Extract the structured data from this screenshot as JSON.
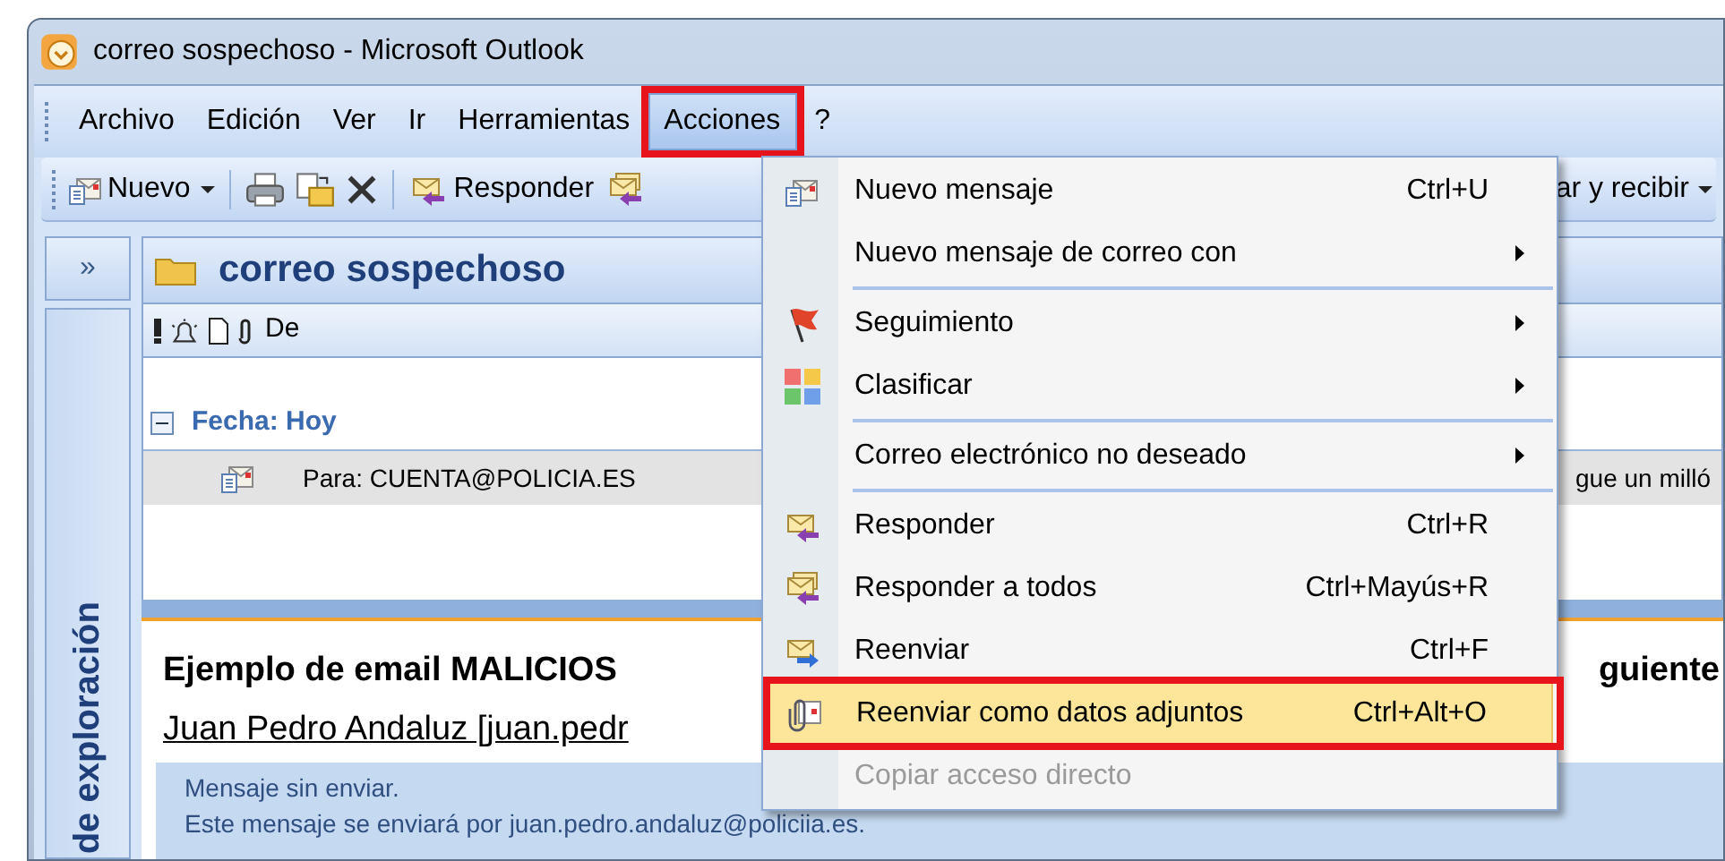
{
  "window": {
    "title": "correo sospechoso - Microsoft Outlook"
  },
  "menu_bar": [
    {
      "label": "Archivo",
      "selected": false,
      "annotated": false
    },
    {
      "label": "Edición",
      "selected": false,
      "annotated": false
    },
    {
      "label": "Ver",
      "selected": false,
      "annotated": false
    },
    {
      "label": "Ir",
      "selected": false,
      "annotated": false
    },
    {
      "label": "Herramientas",
      "selected": false,
      "annotated": false
    },
    {
      "label": "Acciones",
      "selected": true,
      "annotated": true
    },
    {
      "label": "?",
      "selected": false,
      "annotated": false
    }
  ],
  "toolbar": {
    "new_button": "Nuevo",
    "reply_button": "Responder",
    "send_receive_button": "ar y recibir"
  },
  "nav_pane": {
    "expand_button": "»",
    "title": "de exploración"
  },
  "folder": {
    "title": "correo sospechoso",
    "columns": [
      "De"
    ],
    "group": {
      "label": "Fecha: Hoy",
      "expanded": true
    },
    "messages": [
      {
        "to": "Para: CUENTA@POLICIA.ES",
        "subject": "gue un milló",
        "selected": true
      }
    ]
  },
  "reading_pane": {
    "subject_start": "Ejemplo de email MALICIOS",
    "subject_end": "guiente",
    "sender": "Juan Pedro Andaluz [juan.pedr",
    "info": [
      "Mensaje sin enviar.",
      "Este mensaje se enviará por juan.pedro.andaluz@policiia.es."
    ]
  },
  "context_menu": {
    "items": [
      {
        "label": "Nuevo mensaje",
        "shortcut": "Ctrl+U",
        "submenu": false,
        "disabled": false,
        "selected": false,
        "annotated": false,
        "separator_before": false
      },
      {
        "label": "Nuevo mensaje de correo con",
        "submenu": true,
        "disabled": false,
        "selected": false,
        "annotated": false,
        "separator_before": false
      },
      {
        "label": "Seguimiento",
        "submenu": true,
        "disabled": false,
        "selected": false,
        "annotated": false,
        "separator_before": true
      },
      {
        "label": "Clasificar",
        "submenu": true,
        "disabled": false,
        "selected": false,
        "annotated": false,
        "separator_before": false
      },
      {
        "label": "Correo electrónico no deseado",
        "submenu": true,
        "disabled": false,
        "selected": false,
        "annotated": false,
        "separator_before": true
      },
      {
        "label": "Responder",
        "shortcut": "Ctrl+R",
        "submenu": false,
        "disabled": false,
        "selected": false,
        "annotated": false,
        "separator_before": true
      },
      {
        "label": "Responder a todos",
        "shortcut": "Ctrl+Mayús+R",
        "submenu": false,
        "disabled": false,
        "selected": false,
        "annotated": false,
        "separator_before": false
      },
      {
        "label": "Reenviar",
        "shortcut": "Ctrl+F",
        "submenu": false,
        "disabled": false,
        "selected": false,
        "annotated": false,
        "separator_before": false
      },
      {
        "label": "Reenviar como datos adjuntos",
        "shortcut": "Ctrl+Alt+O",
        "submenu": false,
        "disabled": false,
        "selected": true,
        "annotated": true,
        "separator_before": false
      },
      {
        "label": "Copiar acceso directo",
        "submenu": false,
        "disabled": true,
        "selected": false,
        "annotated": false,
        "separator_before": false
      }
    ]
  }
}
